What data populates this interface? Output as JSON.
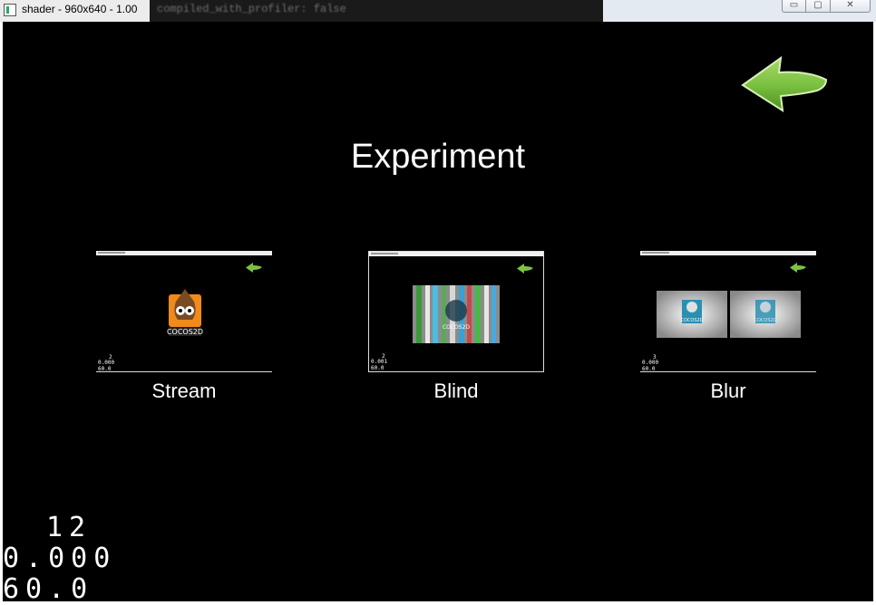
{
  "window": {
    "title": "shader - 960x640 - 1.00",
    "console_text": "compiled_with_profiler: false",
    "buttons": {
      "minimize": "▭",
      "maximize": "▢",
      "close": "✕"
    }
  },
  "scene": {
    "title": "Experiment",
    "back_arrow_color": "#7cc242",
    "tiles": [
      {
        "label": "Stream",
        "stats": [
          "2",
          "0.000",
          "60.0"
        ]
      },
      {
        "label": "Blind",
        "stats": [
          "2",
          "0.001",
          "60.0"
        ]
      },
      {
        "label": "Blur",
        "stats": [
          "3",
          "0.000",
          "60.0"
        ]
      }
    ],
    "logo_text": {
      "stream": "COCOS2D",
      "blind": "COCOS2D",
      "blur_left": "COCOS2D",
      "blur_right": "COCOS2D"
    }
  },
  "stats": {
    "draw_calls": "12",
    "frame_time": "0.000",
    "fps": "60.0"
  }
}
